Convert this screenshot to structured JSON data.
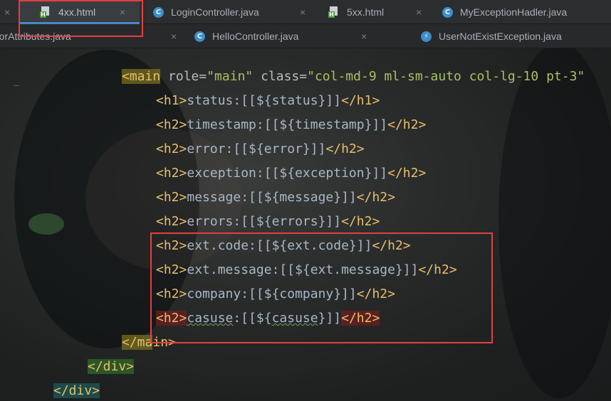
{
  "tabs_row1": [
    {
      "label": "4xx.html",
      "icon": "html-file-icon",
      "active": true
    },
    {
      "label": "LoginController.java",
      "icon": "java-class-icon"
    },
    {
      "label": "5xx.html",
      "icon": "html-file-icon"
    },
    {
      "label": "MyExceptionHadler.java",
      "icon": "java-class-icon"
    }
  ],
  "tabs_row2": [
    {
      "label": "rorAttributes.java",
      "icon": "java-class-icon"
    },
    {
      "label": "HelloController.java",
      "icon": "java-class-icon"
    },
    {
      "label": "UserNotExistException.java",
      "icon": "exception-class-icon"
    }
  ],
  "close_glyph": "×",
  "code": {
    "main_open": {
      "tag_open": "<main",
      "sp1": " ",
      "attr1": "role=",
      "val1": "\"main\"",
      "sp2": " ",
      "attr2": "class=",
      "val2": "\"col-md-9 ml-sm-auto col-lg-10 pt-3\""
    },
    "lines": [
      {
        "open": "<h1>",
        "text": "status:[[${status}]]",
        "close": "</h1>"
      },
      {
        "open": "<h2>",
        "text": "timestamp:[[${timestamp}]]",
        "close": "</h2>"
      },
      {
        "open": "<h2>",
        "text": "error:[[${error}]]",
        "close": "</h2>"
      },
      {
        "open": "<h2>",
        "text": "exception:[[${exception}]]",
        "close": "</h2>"
      },
      {
        "open": "<h2>",
        "text": "message:[[${message}]]",
        "close": "</h2>"
      },
      {
        "open": "<h2>",
        "text": "errors:[[${errors}]]",
        "close": "</h2>"
      },
      {
        "open": "<h2>",
        "text": "ext.code:[[${ext.code}]]",
        "close": "</h2>"
      },
      {
        "open": "<h2>",
        "text": "ext.message:[[${ext.message}]]",
        "close": "</h2>"
      },
      {
        "open": "<h2>",
        "text": "company:[[${company}]]",
        "close": "</h2>"
      },
      {
        "open": "<h2>",
        "text_a": "casuse",
        "text_b": ":[[${",
        "text_c": "casuse",
        "text_d": "}]]",
        "close": "</h2>"
      }
    ],
    "main_close": {
      "a": "</ma",
      "b": "in>"
    },
    "div_close_1": "</div>",
    "div_close_2": "</div>"
  },
  "colors": {
    "tag": "#e8bf6a",
    "text": "#a9b7c6",
    "value": "#a5c261",
    "annotation": "#e34040"
  }
}
